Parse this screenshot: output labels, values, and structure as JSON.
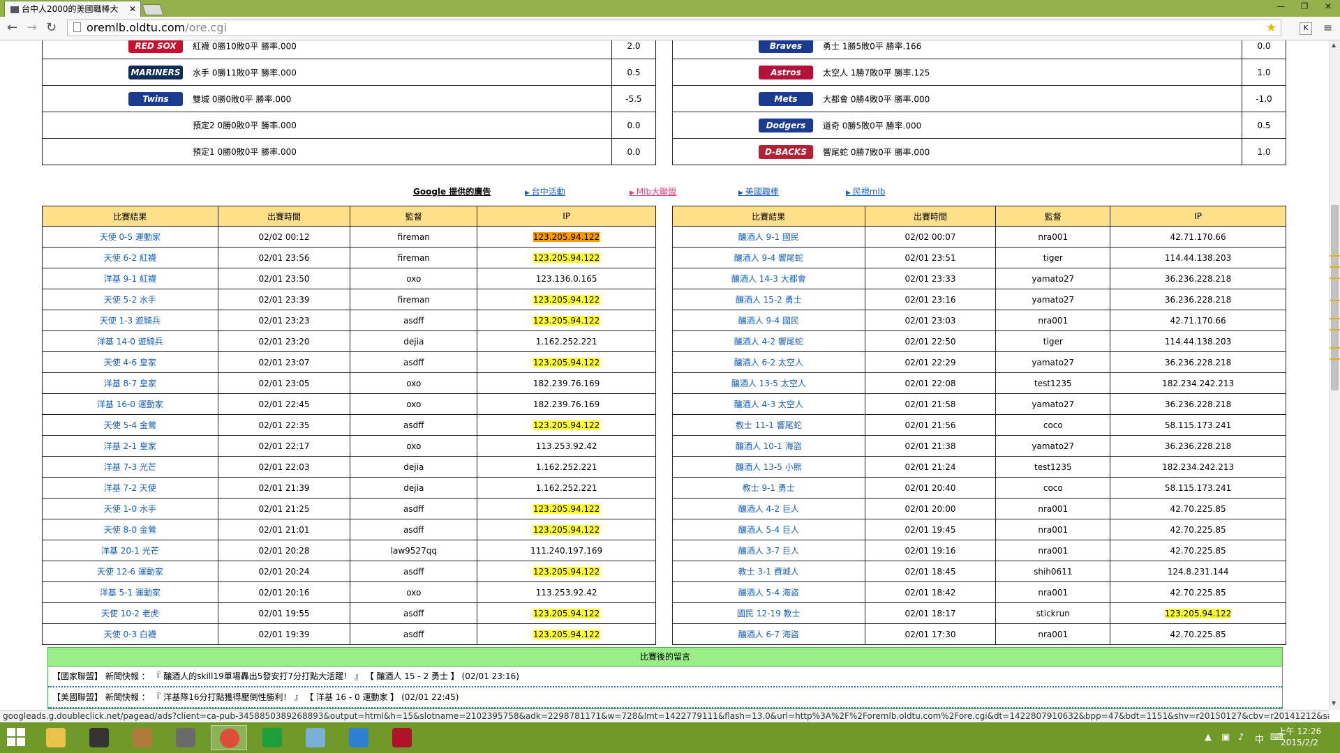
{
  "browser": {
    "tab_title": "台中人2000的美國職棒大",
    "url_host": "oremlb.oldtu.com",
    "url_path": "/ore.cgi",
    "status_url": "googleads.g.doubleclick.net/pagead/ads?client=ca-pub-3458850389268893&output=html&h=15&slotname=2102395758&adk=2298781171&w=728&lmt=1422779111&flash=13.0&url=http%3A%2F%2Foremlb.oldtu.com%2Fore.cgi&dt=1422807910632&bpp=47&bdt=1151&shv=r20150127&cbv=r20141212&saldr=sa&corr..."
  },
  "standings": {
    "left": [
      {
        "team": "紅襪 0勝10敗0平 勝率.000",
        "gb": "2.0",
        "logo": "RED SOX",
        "color": "#c8102e"
      },
      {
        "team": "水手 0勝11敗0平 勝率.000",
        "gb": "0.5",
        "logo": "MARINERS",
        "color": "#0c2c56"
      },
      {
        "team": "雙城 0勝0敗0平 勝率.000",
        "gb": "-5.5",
        "logo": "Twins",
        "color": "#1a3b8f"
      },
      {
        "team": "預定2 0勝0敗0平 勝率.000",
        "gb": "0.0",
        "logo": "",
        "color": ""
      },
      {
        "team": "預定1 0勝0敗0平 勝率.000",
        "gb": "0.0",
        "logo": "",
        "color": ""
      }
    ],
    "right": [
      {
        "team": "勇士 1勝5敗0平 勝率.166",
        "gb": "0.0",
        "logo": "Braves",
        "color": "#1a3b8f"
      },
      {
        "team": "太空人 1勝7敗0平 勝率.125",
        "gb": "1.0",
        "logo": "Astros",
        "color": "#b5123a"
      },
      {
        "team": "大都會 0勝4敗0平 勝率.000",
        "gb": "-1.0",
        "logo": "Mets",
        "color": "#1a3b8f"
      },
      {
        "team": "道奇 0勝5敗0平 勝率.000",
        "gb": "0.5",
        "logo": "Dodgers",
        "color": "#1a3b8f"
      },
      {
        "team": "響尾蛇 0勝7敗0平 勝率.000",
        "gb": "1.0",
        "logo": "D-BACKS",
        "color": "#b22234"
      }
    ]
  },
  "ads": {
    "google": "Google 提供的廣告",
    "links": [
      {
        "label": "台中活動",
        "color": "#1a5fb4"
      },
      {
        "label": "Mlb大聯盟",
        "color": "#e0407a"
      },
      {
        "label": "美國職棒",
        "color": "#1a5fb4"
      },
      {
        "label": "民視mlb",
        "color": "#1a5fb4"
      }
    ]
  },
  "results": {
    "headers": [
      "比賽結果",
      "出賽時間",
      "監督",
      "IP"
    ],
    "left": [
      {
        "game": "天使 0-5 運動家",
        "time": "02/02 00:12",
        "mgr": "fireman",
        "ip": "123.205.94.122",
        "hl": "orange"
      },
      {
        "game": "天使 6-2 紅襪",
        "time": "02/01 23:56",
        "mgr": "fireman",
        "ip": "123.205.94.122",
        "hl": "yellow"
      },
      {
        "game": "洋基 9-1 紅襪",
        "time": "02/01 23:50",
        "mgr": "oxo",
        "ip": "123.136.0.165",
        "hl": ""
      },
      {
        "game": "天使 5-2 水手",
        "time": "02/01 23:39",
        "mgr": "fireman",
        "ip": "123.205.94.122",
        "hl": "yellow"
      },
      {
        "game": "天使 1-3 遊騎兵",
        "time": "02/01 23:23",
        "mgr": "asdff",
        "ip": "123.205.94.122",
        "hl": "yellow"
      },
      {
        "game": "洋基 14-0 遊騎兵",
        "time": "02/01 23:20",
        "mgr": "dejia",
        "ip": "1.162.252.221",
        "hl": ""
      },
      {
        "game": "天使 4-6 皇家",
        "time": "02/01 23:07",
        "mgr": "asdff",
        "ip": "123.205.94.122",
        "hl": "yellow"
      },
      {
        "game": "洋基 8-7 皇家",
        "time": "02/01 23:05",
        "mgr": "oxo",
        "ip": "182.239.76.169",
        "hl": ""
      },
      {
        "game": "洋基 16-0 運動家",
        "time": "02/01 22:45",
        "mgr": "oxo",
        "ip": "182.239.76.169",
        "hl": ""
      },
      {
        "game": "天使 5-4 金鶯",
        "time": "02/01 22:35",
        "mgr": "asdff",
        "ip": "123.205.94.122",
        "hl": "yellow"
      },
      {
        "game": "洋基 2-1 皇家",
        "time": "02/01 22:17",
        "mgr": "oxo",
        "ip": "113.253.92.42",
        "hl": ""
      },
      {
        "game": "洋基 7-3 光芒",
        "time": "02/01 22:03",
        "mgr": "dejia",
        "ip": "1.162.252.221",
        "hl": ""
      },
      {
        "game": "洋基 7-2 天使",
        "time": "02/01 21:39",
        "mgr": "dejia",
        "ip": "1.162.252.221",
        "hl": ""
      },
      {
        "game": "天使 1-0 水手",
        "time": "02/01 21:25",
        "mgr": "asdff",
        "ip": "123.205.94.122",
        "hl": "yellow"
      },
      {
        "game": "天使 8-0 金鶯",
        "time": "02/01 21:01",
        "mgr": "asdff",
        "ip": "123.205.94.122",
        "hl": "yellow"
      },
      {
        "game": "洋基 20-1 光芒",
        "time": "02/01 20:28",
        "mgr": "law9527qq",
        "ip": "111.240.197.169",
        "hl": ""
      },
      {
        "game": "天使 12-6 運動家",
        "time": "02/01 20:24",
        "mgr": "asdff",
        "ip": "123.205.94.122",
        "hl": "yellow"
      },
      {
        "game": "洋基 5-1 運動家",
        "time": "02/01 20:16",
        "mgr": "oxo",
        "ip": "113.253.92.42",
        "hl": ""
      },
      {
        "game": "天使 10-2 老虎",
        "time": "02/01 19:55",
        "mgr": "asdff",
        "ip": "123.205.94.122",
        "hl": "yellow"
      },
      {
        "game": "天使 0-3 白襪",
        "time": "02/01 19:39",
        "mgr": "asdff",
        "ip": "123.205.94.122",
        "hl": "yellow"
      }
    ],
    "right": [
      {
        "game": "釀酒人 9-1 國民",
        "time": "02/02 00:07",
        "mgr": "nra001",
        "ip": "42.71.170.66",
        "hl": ""
      },
      {
        "game": "釀酒人 9-4 響尾蛇",
        "time": "02/01 23:51",
        "mgr": "tiger",
        "ip": "114.44.138.203",
        "hl": ""
      },
      {
        "game": "釀酒人 14-3 大都會",
        "time": "02/01 23:33",
        "mgr": "yamato27",
        "ip": "36.236.228.218",
        "hl": ""
      },
      {
        "game": "釀酒人 15-2 勇士",
        "time": "02/01 23:16",
        "mgr": "yamato27",
        "ip": "36.236.228.218",
        "hl": ""
      },
      {
        "game": "釀酒人 9-4 國民",
        "time": "02/01 23:03",
        "mgr": "nra001",
        "ip": "42.71.170.66",
        "hl": ""
      },
      {
        "game": "釀酒人 4-2 響尾蛇",
        "time": "02/01 22:50",
        "mgr": "tiger",
        "ip": "114.44.138.203",
        "hl": ""
      },
      {
        "game": "釀酒人 6-2 太空人",
        "time": "02/01 22:29",
        "mgr": "yamato27",
        "ip": "36.236.228.218",
        "hl": ""
      },
      {
        "game": "釀酒人 13-5 太空人",
        "time": "02/01 22:08",
        "mgr": "test1235",
        "ip": "182.234.242.213",
        "hl": ""
      },
      {
        "game": "釀酒人 4-3 太空人",
        "time": "02/01 21:58",
        "mgr": "yamato27",
        "ip": "36.236.228.218",
        "hl": ""
      },
      {
        "game": "教士 11-1 響尾蛇",
        "time": "02/01 21:56",
        "mgr": "coco",
        "ip": "58.115.173.241",
        "hl": ""
      },
      {
        "game": "釀酒人 10-1 海盜",
        "time": "02/01 21:38",
        "mgr": "yamato27",
        "ip": "36.236.228.218",
        "hl": ""
      },
      {
        "game": "釀酒人 13-5 小熊",
        "time": "02/01 21:24",
        "mgr": "test1235",
        "ip": "182.234.242.213",
        "hl": ""
      },
      {
        "game": "教士 9-1 勇士",
        "time": "02/01 20:40",
        "mgr": "coco",
        "ip": "58.115.173.241",
        "hl": ""
      },
      {
        "game": "釀酒人 4-2 巨人",
        "time": "02/01 20:00",
        "mgr": "nra001",
        "ip": "42.70.225.85",
        "hl": ""
      },
      {
        "game": "釀酒人 5-4 巨人",
        "time": "02/01 19:45",
        "mgr": "nra001",
        "ip": "42.70.225.85",
        "hl": ""
      },
      {
        "game": "釀酒人 3-7 巨人",
        "time": "02/01 19:16",
        "mgr": "nra001",
        "ip": "42.70.225.85",
        "hl": ""
      },
      {
        "game": "教士 3-1 費城人",
        "time": "02/01 18:45",
        "mgr": "shih0611",
        "ip": "124.8.231.144",
        "hl": ""
      },
      {
        "game": "釀酒人 5-4 海盜",
        "time": "02/01 18:42",
        "mgr": "nra001",
        "ip": "42.70.225.85",
        "hl": ""
      },
      {
        "game": "國民 12-19 教士",
        "time": "02/01 18:17",
        "mgr": "stickrun",
        "ip": "123.205.94.122",
        "hl": "yellow"
      },
      {
        "game": "釀酒人 6-7 海盜",
        "time": "02/01 17:30",
        "mgr": "nra001",
        "ip": "42.70.225.85",
        "hl": ""
      }
    ]
  },
  "comments": {
    "title": "比賽後的留言",
    "items": [
      "【國家聯盟】 新聞快報 ： 『 釀酒人的skill19單場轟出5發安打7分打點大活躍！ 』 【 釀酒人 15 - 2 勇士 】 (02/01 23:16)",
      "【美國聯盟】 新聞快報 ： 『 洋基隊16分打點獲得壓倒性勝利！ 』 【 洋基 16 - 0 運動家 】 (02/01 22:45)"
    ]
  },
  "taskbar": {
    "icons": [
      {
        "name": "file-explorer-icon",
        "color": "#e8c24a"
      },
      {
        "name": "media-player-icon",
        "color": "#333333"
      },
      {
        "name": "app-icon",
        "color": "#b07a3a"
      },
      {
        "name": "game-icon",
        "color": "#6a6a6a"
      },
      {
        "name": "chrome-icon",
        "color": "#dd4b39"
      },
      {
        "name": "store-icon",
        "color": "#1e9e3a"
      },
      {
        "name": "paint-icon",
        "color": "#7ab0d8"
      },
      {
        "name": "ie-icon",
        "color": "#2f7fd0"
      },
      {
        "name": "power-icon",
        "color": "#b0122a"
      }
    ],
    "ime": "中",
    "time": "上午 12:26",
    "date": "2015/2/2"
  }
}
